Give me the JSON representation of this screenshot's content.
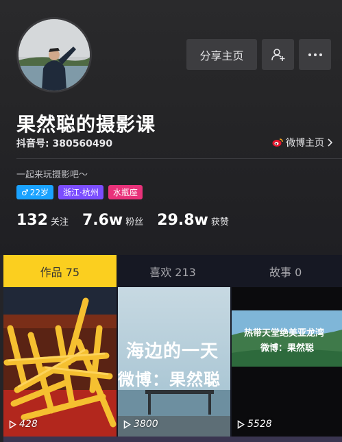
{
  "profile": {
    "name": "果然聪的摄影课",
    "douyin_id": "抖音号: 380560490",
    "weibo_link": "微博主页",
    "bio": "一起来玩摄影吧～",
    "tags": {
      "gender": "22岁",
      "location": "浙江·杭州",
      "zodiac": "水瓶座"
    }
  },
  "actions": {
    "share": "分享主页"
  },
  "stats": [
    {
      "value": "132",
      "label": "关注"
    },
    {
      "value": "7.6w",
      "label": "粉丝"
    },
    {
      "value": "29.8w",
      "label": "获赞"
    }
  ],
  "tabs": [
    {
      "label": "作品 75",
      "active": true
    },
    {
      "label": "喜欢 213",
      "active": false
    },
    {
      "label": "故事 0",
      "active": false
    }
  ],
  "videos": [
    {
      "views": "428",
      "overlay": ""
    },
    {
      "views": "3800",
      "overlay": [
        "海边的一天",
        "微博：果然聪"
      ]
    },
    {
      "views": "5528",
      "overlay": [
        "热带天堂绝美亚龙湾",
        "微博：果然聪"
      ]
    }
  ],
  "colors": {
    "accent": "#fbcf1f",
    "background": "#161823",
    "gender_tag": "#1aa2ff",
    "location_tag": "#7b4dff",
    "zodiac_tag": "#e8327a"
  }
}
